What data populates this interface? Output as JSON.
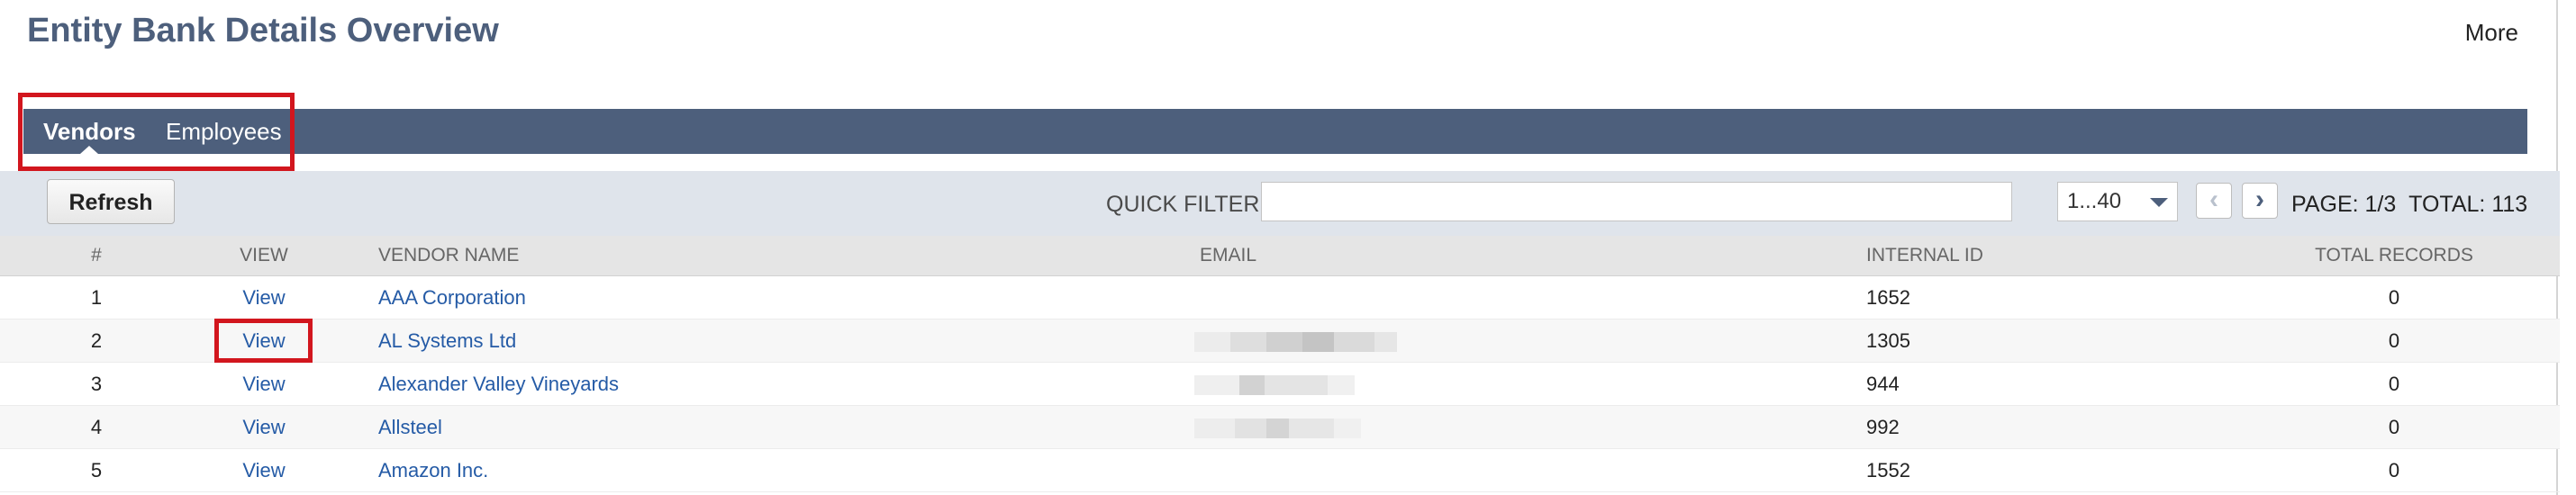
{
  "header": {
    "title": "Entity Bank Details Overview",
    "more_label": "More"
  },
  "tabs": [
    {
      "label": "Vendors",
      "active": true
    },
    {
      "label": "Employees",
      "active": false
    }
  ],
  "toolbar": {
    "refresh_label": "Refresh",
    "quick_filter_label": "QUICK FILTER:",
    "quick_filter_value": "",
    "page_range": "1...40",
    "page_info": "PAGE: 1/3",
    "total_info": "TOTAL: 113"
  },
  "table": {
    "columns": [
      "#",
      "VIEW",
      "VENDOR NAME",
      "EMAIL",
      "INTERNAL ID",
      "TOTAL RECORDS"
    ],
    "rows": [
      {
        "num": "1",
        "view": "View",
        "vendor": "AAA Corporation",
        "email": "",
        "internal_id": "1652",
        "total_records": "0"
      },
      {
        "num": "2",
        "view": "View",
        "vendor": "AL Systems Ltd",
        "email": "[redacted]",
        "internal_id": "1305",
        "total_records": "0"
      },
      {
        "num": "3",
        "view": "View",
        "vendor": "Alexander Valley Vineyards",
        "email": "[redacted]",
        "internal_id": "944",
        "total_records": "0"
      },
      {
        "num": "4",
        "view": "View",
        "vendor": "Allsteel",
        "email": "[redacted]",
        "internal_id": "992",
        "total_records": "0"
      },
      {
        "num": "5",
        "view": "View",
        "vendor": "Amazon Inc.",
        "email": "",
        "internal_id": "1552",
        "total_records": "0"
      }
    ]
  },
  "icons": {
    "prev": "chevron-left-icon",
    "next": "chevron-right-icon",
    "dropdown": "caret-down-icon"
  },
  "colors": {
    "title": "#4d5f7c",
    "tab_bar": "#4d5f7c",
    "toolbar_bg": "#dfe4eb",
    "link": "#255ba6",
    "highlight": "#d2161e"
  }
}
